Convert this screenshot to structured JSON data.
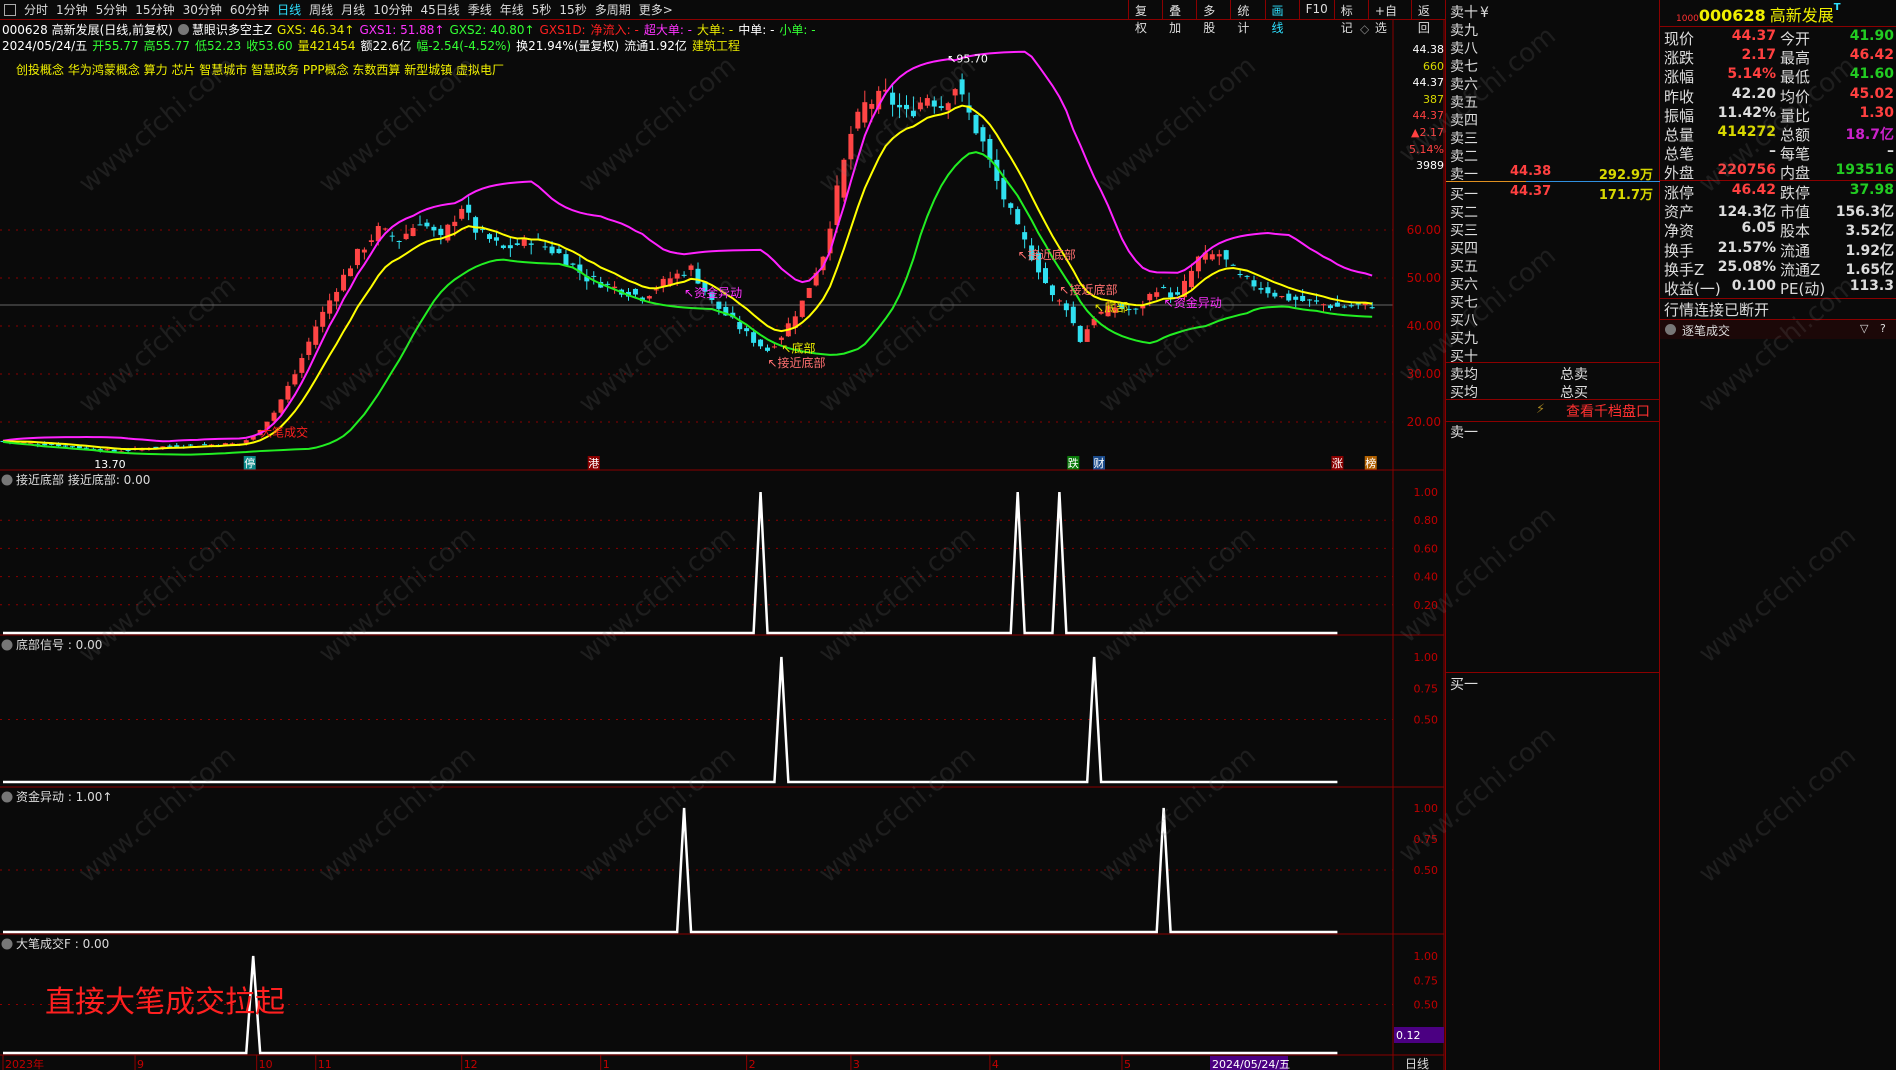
{
  "toolbar": {
    "periods": [
      "分时",
      "1分钟",
      "5分钟",
      "15分钟",
      "30分钟",
      "60分钟",
      "日线",
      "周线",
      "月线",
      "10分钟",
      "45日线",
      "季线",
      "年线",
      "5秒",
      "15秒",
      "多周期",
      "更多>"
    ],
    "active_period": "日线",
    "right_buttons": [
      "复权",
      "叠加",
      "多股",
      "统计",
      "画线",
      "F10",
      "标记",
      "+自选",
      "返回"
    ],
    "active_right": "画线"
  },
  "info_line1": [
    {
      "t": "000628 高新发展(日线,前复权)",
      "c": "#ffffff"
    },
    {
      "t": "慧眼识多空主Z",
      "c": "#ffffff"
    },
    {
      "t": "GXS: 46.34↑",
      "c": "#e8e800"
    },
    {
      "t": "GXS1: 51.88↑",
      "c": "#ff33ff"
    },
    {
      "t": "GXS2: 40.80↑",
      "c": "#33ff33"
    },
    {
      "t": "GXS1D:",
      "c": "#ff2020"
    },
    {
      "t": "净流入: -",
      "c": "#ff2020"
    },
    {
      "t": "超大单: -",
      "c": "#ff33ff"
    },
    {
      "t": "大单: -",
      "c": "#e8e800"
    },
    {
      "t": "中单: -",
      "c": "#ffffff"
    },
    {
      "t": "小单: -",
      "c": "#33ff33"
    }
  ],
  "info_line2": [
    {
      "t": "2024/05/24/五",
      "c": "#ffffff"
    },
    {
      "t": "开55.77",
      "c": "#33ff33"
    },
    {
      "t": "高55.77",
      "c": "#33ff33"
    },
    {
      "t": "低52.23",
      "c": "#33ff33"
    },
    {
      "t": "收53.60",
      "c": "#33ff33"
    },
    {
      "t": "量421454",
      "c": "#e8e800"
    },
    {
      "t": "额22.6亿",
      "c": "#ffffff"
    },
    {
      "t": "幅-2.54(-4.52%)",
      "c": "#33ff33"
    },
    {
      "t": "换21.94%(量复权)",
      "c": "#ffffff"
    },
    {
      "t": "流通1.92亿",
      "c": "#ffffff"
    },
    {
      "t": "建筑工程",
      "c": "#e8e800"
    }
  ],
  "concepts": "创投概念 华为鸿蒙概念 算力 芯片 智慧城市 智慧政务 PPP概念 东数西算 新型城镇 虚拟电厂",
  "axis_box": [
    {
      "t": "44.38",
      "c": "#ffffff"
    },
    {
      "t": "660",
      "c": "#d8d800"
    },
    {
      "t": "44.37",
      "c": "#ffffff"
    },
    {
      "t": "387",
      "c": "#d8d800"
    },
    {
      "t": "44.37",
      "c": "#ff4040"
    },
    {
      "t": "▲2.17",
      "c": "#ff4040"
    },
    {
      "t": "5.14%",
      "c": "#ff4040"
    },
    {
      "t": "3989",
      "c": "#ffffff"
    }
  ],
  "chart_data": {
    "type": "candlestick",
    "price_ticks": [
      "60.00",
      "50.00",
      "40.00",
      "30.00",
      "20.00"
    ],
    "current_price": 44.37,
    "high_label": "95.70",
    "high_value": 95.7,
    "low_label": "13.70",
    "low_value": 13.7,
    "bar_count": 198,
    "key_closes": [
      [
        0,
        16
      ],
      [
        8,
        15.2
      ],
      [
        16,
        13.9
      ],
      [
        24,
        15
      ],
      [
        34,
        15.5
      ],
      [
        36,
        17
      ],
      [
        39,
        22
      ],
      [
        42,
        30
      ],
      [
        45,
        40
      ],
      [
        48,
        48
      ],
      [
        51,
        55
      ],
      [
        54,
        60
      ],
      [
        57,
        58
      ],
      [
        60,
        62
      ],
      [
        63,
        58
      ],
      [
        66,
        65
      ],
      [
        68,
        60
      ],
      [
        72,
        56
      ],
      [
        76,
        58
      ],
      [
        80,
        55
      ],
      [
        84,
        50
      ],
      [
        88,
        48
      ],
      [
        92,
        46
      ],
      [
        96,
        50
      ],
      [
        99,
        52
      ],
      [
        102,
        45
      ],
      [
        105,
        41
      ],
      [
        108,
        37
      ],
      [
        110,
        35
      ],
      [
        112,
        38
      ],
      [
        115,
        45
      ],
      [
        118,
        55
      ],
      [
        120,
        68
      ],
      [
        122,
        80
      ],
      [
        124,
        86
      ],
      [
        127,
        88
      ],
      [
        130,
        84
      ],
      [
        133,
        88
      ],
      [
        135,
        86
      ],
      [
        137,
        90
      ],
      [
        139,
        84
      ],
      [
        141,
        78
      ],
      [
        143,
        70
      ],
      [
        146,
        60
      ],
      [
        149,
        52
      ],
      [
        151,
        46
      ],
      [
        153,
        44
      ],
      [
        155,
        37
      ],
      [
        157,
        42
      ],
      [
        160,
        44
      ],
      [
        163,
        43
      ],
      [
        166,
        48
      ],
      [
        169,
        46
      ],
      [
        172,
        54
      ],
      [
        175,
        55
      ],
      [
        178,
        50
      ],
      [
        181,
        48
      ],
      [
        184,
        46
      ],
      [
        188,
        45
      ],
      [
        192,
        44
      ],
      [
        197,
        44.37
      ]
    ],
    "annotations": [
      {
        "bar": 37,
        "price": 17,
        "text": "大笔成交",
        "color": "#ff2020"
      },
      {
        "bar": 98,
        "price": 46,
        "text": "↖资金异动",
        "color": "#ff33ff"
      },
      {
        "bar": 112,
        "price": 34.5,
        "text": "↖底部",
        "color": "#e8e800"
      },
      {
        "bar": 110,
        "price": 31.5,
        "text": "↖接近底部",
        "color": "#ff7070"
      },
      {
        "bar": 146,
        "price": 54,
        "text": "↖接近底部",
        "color": "#ff7070"
      },
      {
        "bar": 152,
        "price": 46.7,
        "text": "↖接近底部",
        "color": "#ff7070"
      },
      {
        "bar": 157,
        "price": 43,
        "text": "↖底部",
        "color": "#e8e800"
      },
      {
        "bar": 167,
        "price": 44,
        "text": "↖资金异动",
        "color": "#ff33ff"
      }
    ],
    "badges": [
      {
        "bar": 35.5,
        "text": "停",
        "color": "#0b8a8a"
      },
      {
        "bar": 85,
        "text": "港",
        "color": "#8b0000"
      },
      {
        "bar": 154,
        "text": "跌",
        "color": "#0a7a0a"
      },
      {
        "bar": 157.7,
        "text": "财",
        "color": "#1a4a8a"
      },
      {
        "bar": 192,
        "text": "涨",
        "color": "#8b0000"
      },
      {
        "bar": 196.8,
        "text": "榜",
        "color": "#b06000"
      }
    ],
    "x_labels": [
      {
        "bar": 0,
        "text": "2023年"
      },
      {
        "bar": 19,
        "text": "9"
      },
      {
        "bar": 36.5,
        "text": "10"
      },
      {
        "bar": 45,
        "text": "11"
      },
      {
        "bar": 66,
        "text": "12"
      },
      {
        "bar": 86,
        "text": "1"
      },
      {
        "bar": 107,
        "text": "2"
      },
      {
        "bar": 122,
        "text": "3"
      },
      {
        "bar": 142,
        "text": "4"
      },
      {
        "bar": 161,
        "text": "5"
      }
    ],
    "cursor_date": "2024/05/24/五",
    "period_label": "日线",
    "panels": [
      {
        "title": "接近底部 接近底部: 0.00",
        "ticks": [
          "1.00",
          "0.80",
          "0.60",
          "0.40",
          "0.20"
        ],
        "tick_values": [
          1,
          0.8,
          0.6,
          0.4,
          0.2
        ],
        "spikes": [
          109,
          146,
          152
        ]
      },
      {
        "title": "底部信号 : 0.00",
        "ticks": [
          "1.00",
          "0.75",
          "0.50"
        ],
        "tick_values": [
          1,
          0.75,
          0.5
        ],
        "spikes": [
          112,
          157
        ]
      },
      {
        "title": "资金异动 : 1.00↑",
        "ticks": [
          "1.00",
          "0.75",
          "0.50"
        ],
        "tick_values": [
          1,
          0.75,
          0.5
        ],
        "spikes": [
          98,
          167
        ]
      },
      {
        "title": "大笔成交F : 0.00",
        "ticks": [
          "1.00",
          "0.75",
          "0.50"
        ],
        "tick_values": [
          1,
          0.75,
          0.5
        ],
        "spikes": [
          36
        ],
        "note": "直接大笔成交拉起",
        "cursor_value": "0.12"
      }
    ]
  },
  "orderbook": {
    "sell_labels": [
      "卖十",
      "卖九",
      "卖八",
      "卖七",
      "卖六",
      "卖五",
      "卖四",
      "卖三",
      "卖二",
      "卖一"
    ],
    "currency": "¥",
    "sell1_price": "44.38",
    "sell1_vol": "292.9万",
    "buy_labels": [
      "买一",
      "买二",
      "买三",
      "买四",
      "买五",
      "买六",
      "买七",
      "买八",
      "买九",
      "买十"
    ],
    "buy1_price": "44.37",
    "buy1_vol": "171.7万",
    "sell_avg": "卖均",
    "total_sell": "总卖",
    "buy_avg": "买均",
    "total_buy": "总买",
    "thousand_levels": "查看千档盘口",
    "lower_sell": "卖一",
    "lower_buy": "买一"
  },
  "quote": {
    "prefix": "1000",
    "code": "000628",
    "name": "高新发展",
    "rows1": [
      [
        "现价",
        "44.37",
        "#ff4040",
        "今开",
        "41.90",
        "#22cc22"
      ],
      [
        "涨跌",
        "2.17",
        "#ff4040",
        "最高",
        "46.42",
        "#ff4040"
      ],
      [
        "涨幅",
        "5.14%",
        "#ff4040",
        "最低",
        "41.60",
        "#22cc22"
      ],
      [
        "昨收",
        "42.20",
        "#dddddd",
        "均价",
        "45.02",
        "#ff4040"
      ],
      [
        "振幅",
        "11.42%",
        "#dddddd",
        "量比",
        "1.30",
        "#ff4040"
      ],
      [
        "总量",
        "414272",
        "#d8d800",
        "总额",
        "18.7亿",
        "#cc22cc"
      ],
      [
        "总笔",
        "–",
        "#dddddd",
        "每笔",
        "–",
        "#dddddd"
      ],
      [
        "外盘",
        "220756",
        "#ff4040",
        "内盘",
        "193516",
        "#22cc22"
      ]
    ],
    "rows2": [
      [
        "涨停",
        "46.42",
        "#ff4040",
        "跌停",
        "37.98",
        "#22cc22"
      ],
      [
        "资产",
        "124.3亿",
        "#dddddd",
        "市值",
        "156.3亿",
        "#dddddd"
      ],
      [
        "净资",
        "6.05",
        "#dddddd",
        "股本",
        "3.52亿",
        "#dddddd"
      ],
      [
        "换手",
        "21.57%",
        "#dddddd",
        "流通",
        "1.92亿",
        "#dddddd"
      ],
      [
        "换手Z",
        "25.08%",
        "#dddddd",
        "流通Z",
        "1.65亿",
        "#dddddd"
      ],
      [
        "收益(一)",
        "0.100",
        "#dddddd",
        "PE(动)",
        "113.3",
        "#dddddd"
      ]
    ],
    "status": "行情连接已断开",
    "ticks_title": "逐笔成交"
  },
  "watermark": "www.cfchi.com"
}
